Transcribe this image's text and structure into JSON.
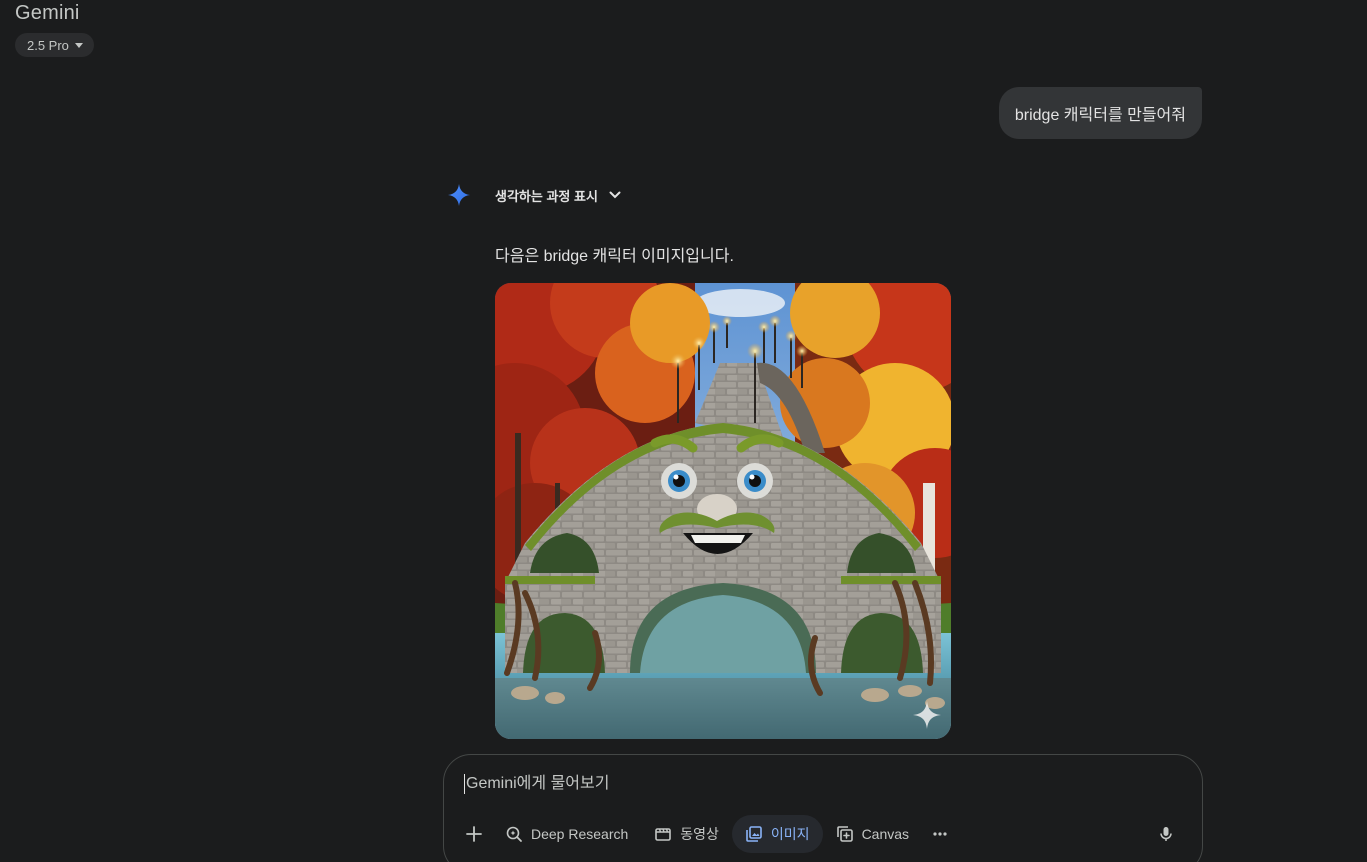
{
  "header": {
    "brand": "Gemini",
    "model": "2.5 Pro"
  },
  "conversation": {
    "user_message": "bridge 캐릭터를 만들어줘",
    "thinking_label": "생각하는 과정 표시",
    "response_text": "다음은 bridge 캐릭터 이미지입니다."
  },
  "composer": {
    "placeholder": "Gemini에게 물어보기",
    "tools": [
      {
        "label": "Deep Research",
        "icon": "deep-research-icon"
      },
      {
        "label": "동영상",
        "icon": "video-icon"
      },
      {
        "label": "이미지",
        "icon": "image-icon",
        "active": true
      },
      {
        "label": "Canvas",
        "icon": "canvas-icon"
      }
    ]
  },
  "colors": {
    "background": "#1b1c1d",
    "bubble": "#333537",
    "accent": "#8ab4f8",
    "spark": "#4285f4"
  }
}
